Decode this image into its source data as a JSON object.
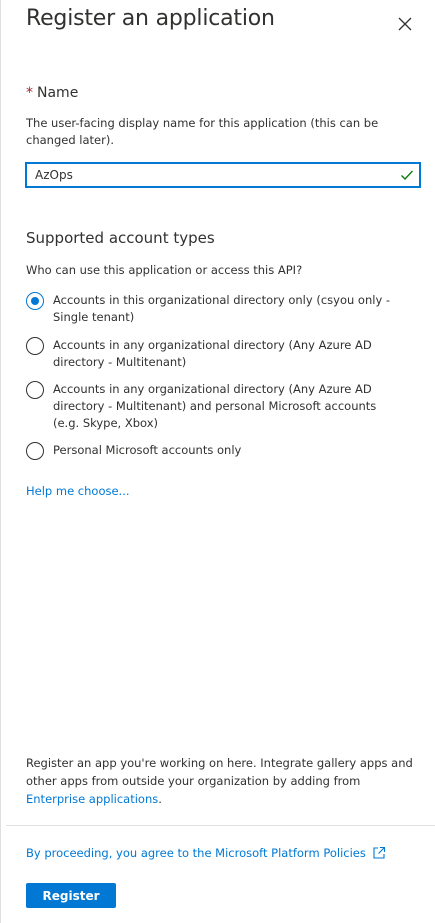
{
  "header": {
    "title": "Register an application",
    "close_icon": "close-icon"
  },
  "name_field": {
    "required_marker": "*",
    "label": "Name",
    "description": "The user-facing display name for this application (this can be changed later).",
    "value": "AzOps",
    "valid_icon": "checkmark-icon",
    "valid_color": "#107c10"
  },
  "account_types": {
    "title": "Supported account types",
    "question": "Who can use this application or access this API?",
    "options": [
      {
        "label": "Accounts in this organizational directory only (csyou only - Single tenant)",
        "selected": true
      },
      {
        "label": "Accounts in any organizational directory (Any Azure AD directory - Multitenant)",
        "selected": false
      },
      {
        "label": "Accounts in any organizational directory (Any Azure AD directory - Multitenant) and personal Microsoft accounts (e.g. Skype, Xbox)",
        "selected": false
      },
      {
        "label": "Personal Microsoft accounts only",
        "selected": false
      }
    ],
    "help_link": "Help me choose..."
  },
  "footer": {
    "info_text": "Register an app you're working on here. Integrate gallery apps and other apps from outside your organization by adding from",
    "info_link": "Enterprise applications",
    "info_suffix": ".",
    "policy_link": "By proceeding, you agree to the Microsoft Platform Policies",
    "external_icon": "external-link-icon",
    "register_label": "Register"
  },
  "colors": {
    "accent": "#0078d4",
    "text": "#323130",
    "required": "#a4262c",
    "valid": "#107c10"
  }
}
